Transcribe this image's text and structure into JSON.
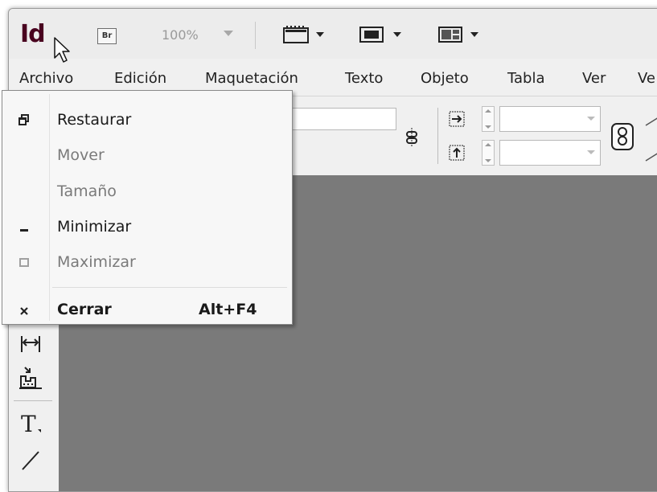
{
  "app": {
    "logo_text": "Id",
    "bridge_label": "Br",
    "zoom_value": "100%"
  },
  "menubar": {
    "items": [
      "Archivo",
      "Edición",
      "Maquetación",
      "Texto",
      "Objeto",
      "Tabla",
      "Ver",
      "Ve"
    ]
  },
  "system_menu": {
    "items": [
      {
        "label": "Restaurar",
        "icon": "restore-icon",
        "enabled": true
      },
      {
        "label": "Mover",
        "icon": "",
        "enabled": false
      },
      {
        "label": "Tamaño",
        "icon": "",
        "enabled": false
      },
      {
        "label": "Minimizar",
        "icon": "minimize-icon",
        "enabled": true
      },
      {
        "label": "Maximizar",
        "icon": "maximize-icon",
        "enabled": false
      },
      {
        "label": "Cerrar",
        "icon": "close-icon",
        "enabled": true,
        "shortcut": "Alt+F4"
      }
    ]
  },
  "colors": {
    "logo": "#49021f",
    "canvas": "#7a7a7a",
    "menu_bg": "#f7f7f7"
  }
}
